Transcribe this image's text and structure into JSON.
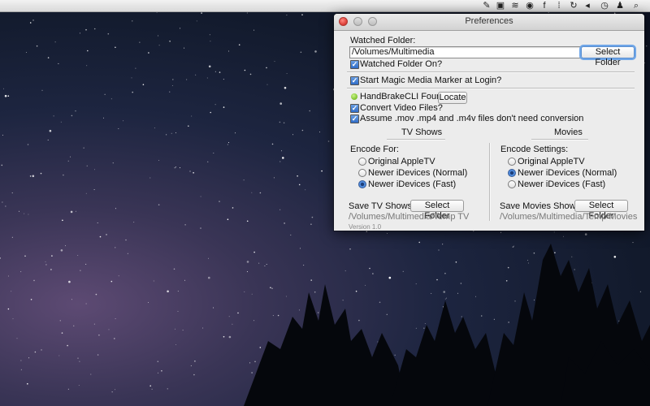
{
  "window": {
    "title": "Preferences"
  },
  "watched": {
    "label": "Watched Folder:",
    "path": "/Volumes/Multimedia",
    "select_button": "Select Folder",
    "on_label": "Watched Folder On?"
  },
  "login": {
    "label": "Start Magic Media Marker at Login?"
  },
  "handbrake": {
    "label": "HandBrakeCLI Found?",
    "locate_button": "Locate",
    "convert_label": "Convert Video Files?",
    "assume_label": "Assume .mov .mp4 and .m4v files don't need conversion"
  },
  "tv": {
    "header": "TV Shows",
    "encode_label": "Encode For:",
    "options": [
      "Original AppleTV",
      "Newer iDevices (Normal)",
      "Newer iDevices (Fast)"
    ],
    "selected_index": 2,
    "save_label": "Save TV Shows to:",
    "select_button": "Select Folder",
    "path": "/Volumes/Multimedia/Temp TV"
  },
  "movies": {
    "header": "Movies",
    "encode_label": "Encode Settings:",
    "options": [
      "Original AppleTV",
      "Newer iDevices (Normal)",
      "Newer iDevices (Fast)"
    ],
    "selected_index": 1,
    "save_label": "Save Movies Shows to:",
    "select_button": "Select Folder",
    "path": "/Volumes/Multimedia/Temp Movies"
  },
  "version": "Version 1.0",
  "menubar_icons": [
    "pen-icon",
    "screen-icon",
    "wifi-status-icon",
    "shield-icon",
    "facebook-icon",
    "dots-icon",
    "sync-icon",
    "volume-icon",
    "time-machine-icon",
    "user-icon",
    "spotlight-icon"
  ],
  "colors": {
    "accent": "#2f6cc7",
    "close_button": "#e0443e",
    "status_ok": "#7cc12a"
  }
}
